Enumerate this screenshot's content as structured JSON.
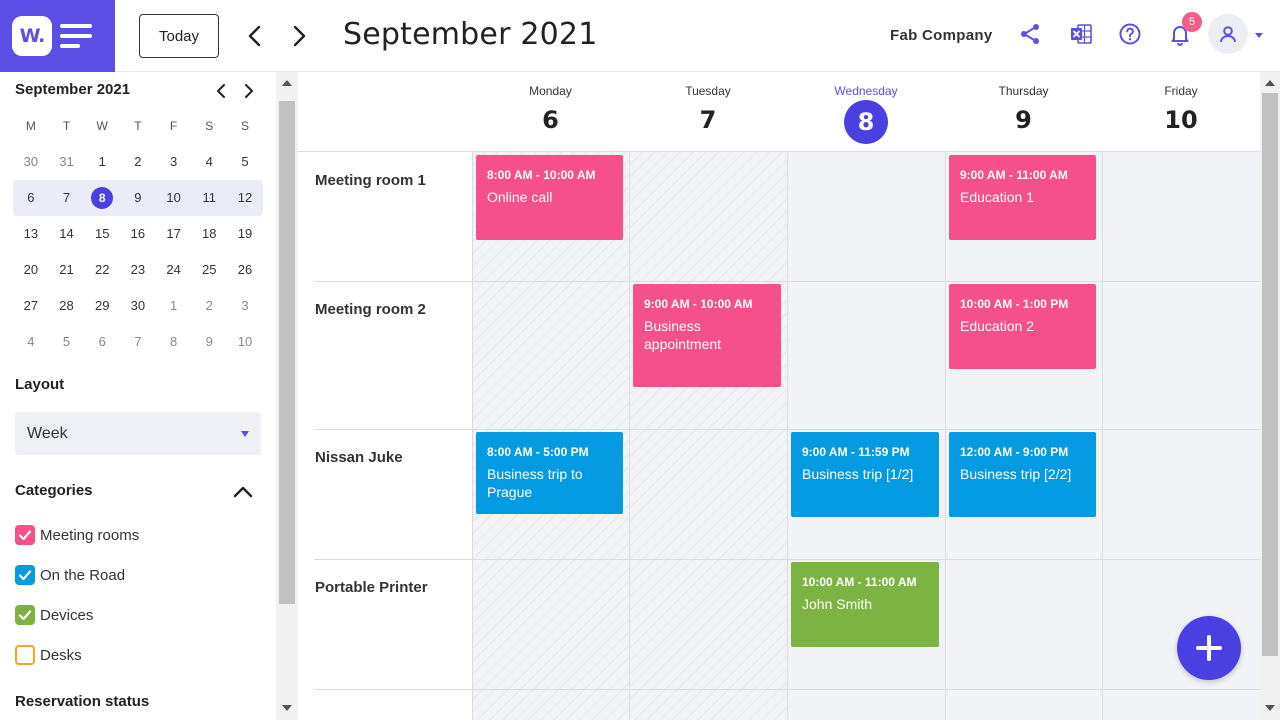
{
  "header": {
    "logo_text": "W.",
    "today_label": "Today",
    "title": "September 2021",
    "company": "Fab Company",
    "notification_count": "5",
    "accent_color": "#5b4fe6"
  },
  "mini_calendar": {
    "title": "September 2021",
    "weekdays": [
      "M",
      "T",
      "W",
      "T",
      "F",
      "S",
      "S"
    ],
    "weeks": [
      [
        "30",
        "31",
        "1",
        "2",
        "3",
        "4",
        "5"
      ],
      [
        "6",
        "7",
        "8",
        "9",
        "10",
        "11",
        "12"
      ],
      [
        "13",
        "14",
        "15",
        "16",
        "17",
        "18",
        "19"
      ],
      [
        "20",
        "21",
        "22",
        "23",
        "24",
        "25",
        "26"
      ],
      [
        "27",
        "28",
        "29",
        "30",
        "1",
        "2",
        "3"
      ],
      [
        "4",
        "5",
        "6",
        "7",
        "8",
        "9",
        "10"
      ]
    ],
    "today": "8"
  },
  "sidebar": {
    "layout_label": "Layout",
    "layout_value": "Week",
    "categories_label": "Categories",
    "categories": [
      {
        "label": "Meeting rooms",
        "checked": true,
        "color": "#f5508a"
      },
      {
        "label": "On the Road",
        "checked": true,
        "color": "#049be2"
      },
      {
        "label": "Devices",
        "checked": true,
        "color": "#7cb342"
      },
      {
        "label": "Desks",
        "checked": false,
        "color": "#f5a623"
      }
    ],
    "reservation_label": "Reservation status"
  },
  "calendar": {
    "days": [
      {
        "name": "Monday",
        "num": "6"
      },
      {
        "name": "Tuesday",
        "num": "7"
      },
      {
        "name": "Wednesday",
        "num": "8",
        "active": true
      },
      {
        "name": "Thursday",
        "num": "9"
      },
      {
        "name": "Friday",
        "num": "10"
      }
    ],
    "resources": [
      "Meeting room 1",
      "Meeting room 2",
      "Nissan Juke",
      "Portable Printer"
    ],
    "events": [
      {
        "time": "8:00 AM - 10:00 AM",
        "title": "Online call",
        "color": "pink"
      },
      {
        "time": "9:00 AM - 11:00 AM",
        "title": "Education 1",
        "color": "pink"
      },
      {
        "time": "9:00 AM - 10:00 AM",
        "title": "Business appointment",
        "color": "pink"
      },
      {
        "time": "10:00 AM - 1:00 PM",
        "title": "Education 2",
        "color": "pink"
      },
      {
        "time": "8:00 AM - 5:00 PM",
        "title": "Business trip to Prague",
        "color": "blue"
      },
      {
        "time": "9:00 AM - 11:59 PM",
        "title": "Business trip [1/2]",
        "color": "blue"
      },
      {
        "time": "12:00 AM - 9:00 PM",
        "title": "Business trip [2/2]",
        "color": "blue"
      },
      {
        "time": "10:00 AM - 11:00 AM",
        "title": "John Smith",
        "color": "green"
      }
    ]
  }
}
